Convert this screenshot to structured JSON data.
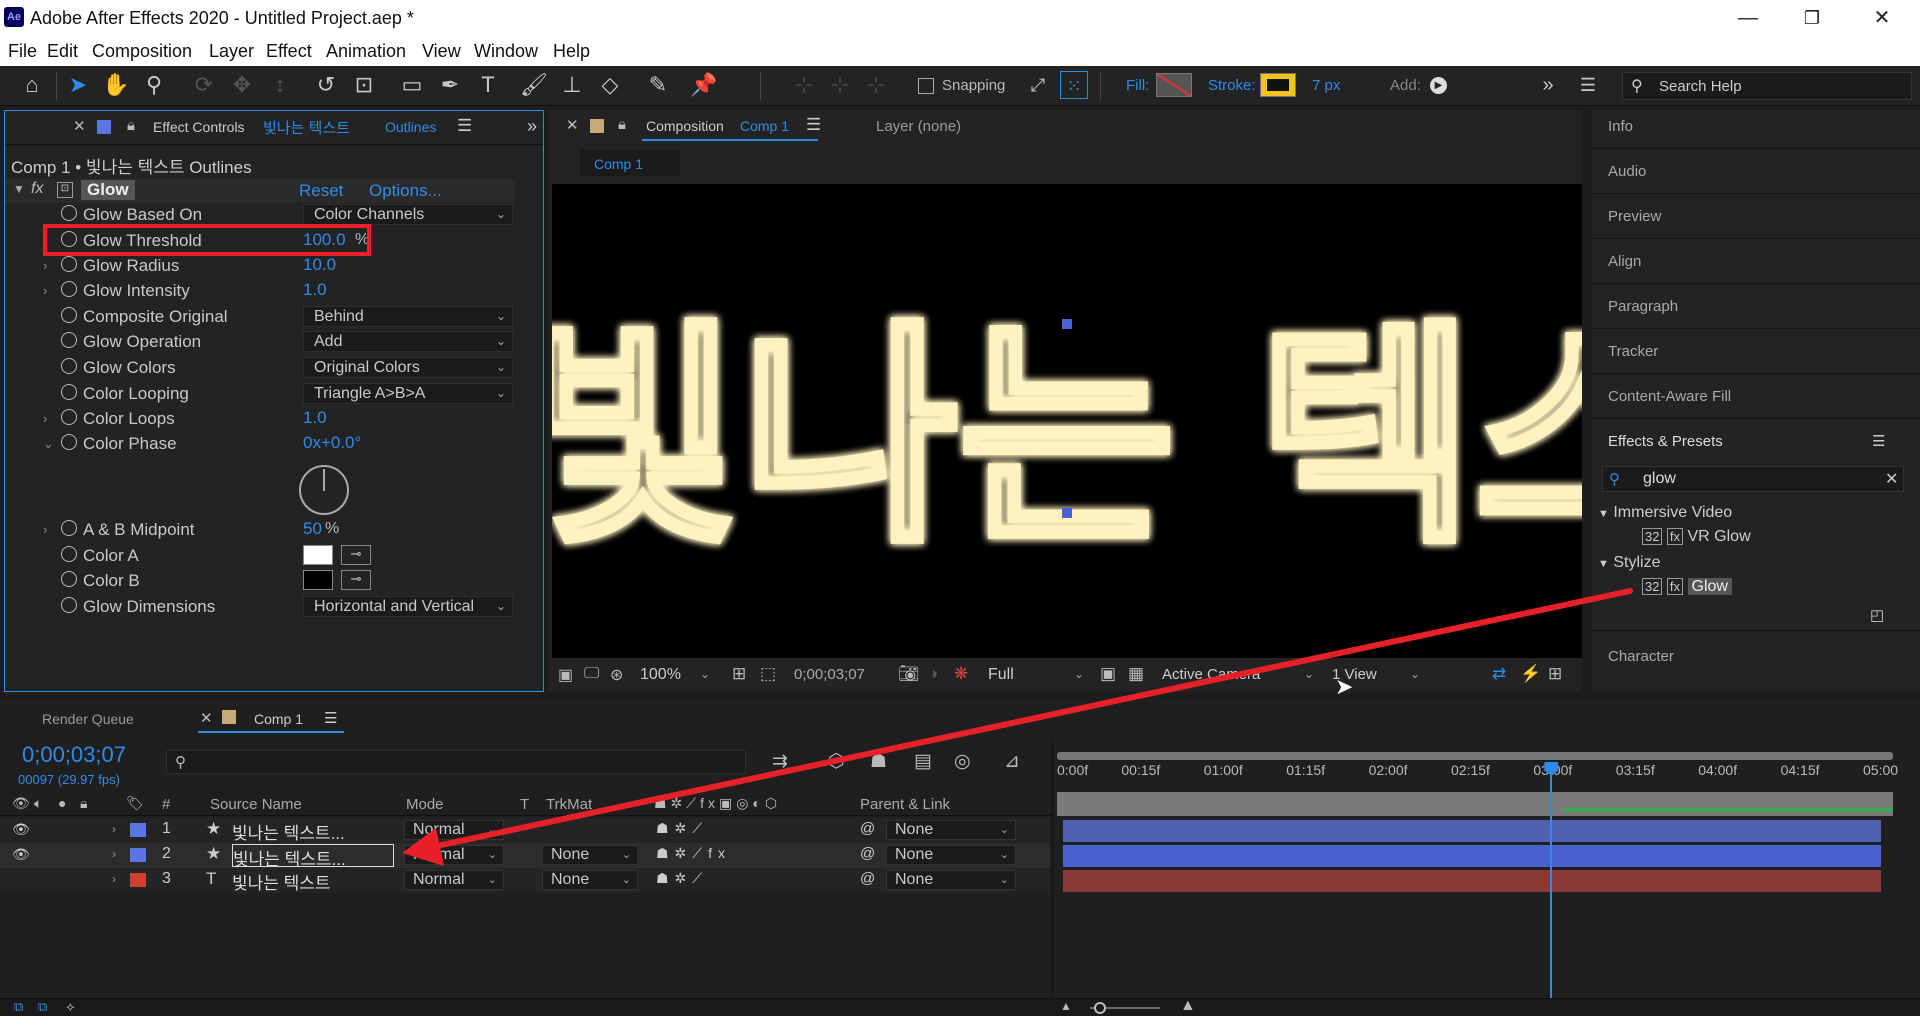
{
  "window": {
    "title": "Adobe After Effects 2020 - Untitled Project.aep *",
    "app_icon": "Ae",
    "minimize": "—",
    "maximize": "❐",
    "close": "✕"
  },
  "menu": [
    "File",
    "Edit",
    "Composition",
    "Layer",
    "Effect",
    "Animation",
    "View",
    "Window",
    "Help"
  ],
  "toolbar": {
    "snapping_label": "Snapping",
    "fill_label": "Fill:",
    "stroke_label": "Stroke:",
    "stroke_width": "7 px",
    "add_label": "Add:",
    "search_placeholder": "Search Help"
  },
  "effect_controls": {
    "tab_label": "Effect Controls",
    "tab_layer": "빛나는 텍스트",
    "tab_layer_suffix": "Outlines",
    "breadcrumb": "Comp 1 • 빛나는 텍스트  Outlines",
    "effect_name": "Glow",
    "reset_label": "Reset",
    "options_label": "Options...",
    "properties": [
      {
        "name": "Glow Based On",
        "value": "Color Channels",
        "kind": "dropdown"
      },
      {
        "name": "Glow Threshold",
        "value": "100.0",
        "unit": "%",
        "kind": "value"
      },
      {
        "name": "Glow Radius",
        "value": "10.0",
        "kind": "value"
      },
      {
        "name": "Glow Intensity",
        "value": "1.0",
        "kind": "value"
      },
      {
        "name": "Composite Original",
        "value": "Behind",
        "kind": "dropdown"
      },
      {
        "name": "Glow Operation",
        "value": "Add",
        "kind": "dropdown"
      },
      {
        "name": "Glow Colors",
        "value": "Original Colors",
        "kind": "dropdown"
      },
      {
        "name": "Color Looping",
        "value": "Triangle A>B>A",
        "kind": "dropdown"
      },
      {
        "name": "Color Loops",
        "value": "1.0",
        "kind": "value"
      },
      {
        "name": "Color Phase",
        "value": "0x+0.0°",
        "kind": "value"
      },
      {
        "name": "A & B Midpoint",
        "value": "50",
        "unit": "%",
        "kind": "value"
      },
      {
        "name": "Color A",
        "value": "#ffffff",
        "kind": "color"
      },
      {
        "name": "Color B",
        "value": "#000000",
        "kind": "color"
      },
      {
        "name": "Glow Dimensions",
        "value": "Horizontal and Vertical",
        "kind": "dropdown"
      }
    ]
  },
  "composition": {
    "tab_label": "Composition",
    "tab_comp": "Comp 1",
    "layer_label": "Layer (none)",
    "subtab": "Comp 1",
    "canvas_text": "빛나는 텍스트",
    "zoom": "100%",
    "timecode": "0;00;03;07",
    "resolution": "Full",
    "camera": "Active Camera",
    "view": "1 View"
  },
  "right_panel": {
    "items": [
      "Info",
      "Audio",
      "Preview",
      "Align",
      "Paragraph",
      "Tracker",
      "Content-Aware Fill"
    ],
    "effects_presets_label": "Effects & Presets",
    "search_value": "glow",
    "groups": [
      {
        "name": "Immersive Video",
        "items": [
          "VR Glow"
        ]
      },
      {
        "name": "Stylize",
        "items": [
          "Glow"
        ]
      }
    ],
    "character_label": "Character"
  },
  "timeline": {
    "render_queue_label": "Render Queue",
    "comp_tab": "Comp 1",
    "current_time": "0;00;03;07",
    "frame_info": "00097 (29.97 fps)",
    "columns": {
      "num": "#",
      "source": "Source Name",
      "mode": "Mode",
      "t": "T",
      "trkmat": "TrkMat",
      "parent": "Parent & Link"
    },
    "ruler": [
      "0:00f",
      "00:15f",
      "01:00f",
      "01:15f",
      "02:00f",
      "02:15f",
      "03:00f",
      "03:15f",
      "04:00f",
      "04:15f",
      "05:00"
    ],
    "playhead_fraction": 0.6,
    "layers": [
      {
        "num": "1",
        "icon": "★",
        "name": "빛나는 텍스트...",
        "mode": "Normal",
        "trkmat": "",
        "parent": "None",
        "color": "#5b75e6",
        "bar_color": "#5060b0"
      },
      {
        "num": "2",
        "icon": "★",
        "name": "빛나는 텍스트...",
        "mode": "Normal",
        "trkmat": "None",
        "parent": "None",
        "color": "#5b75e6",
        "bar_color": "#4a5fd0"
      },
      {
        "num": "3",
        "icon": "T",
        "name": "빛나는 텍스트",
        "mode": "Normal",
        "trkmat": "None",
        "parent": "None",
        "color": "#d04030",
        "bar_color": "#8a3a36"
      }
    ]
  },
  "colors": {
    "accent": "#2d8ceb",
    "annotation": "#e8202a",
    "glow_text": "#ffb347"
  }
}
